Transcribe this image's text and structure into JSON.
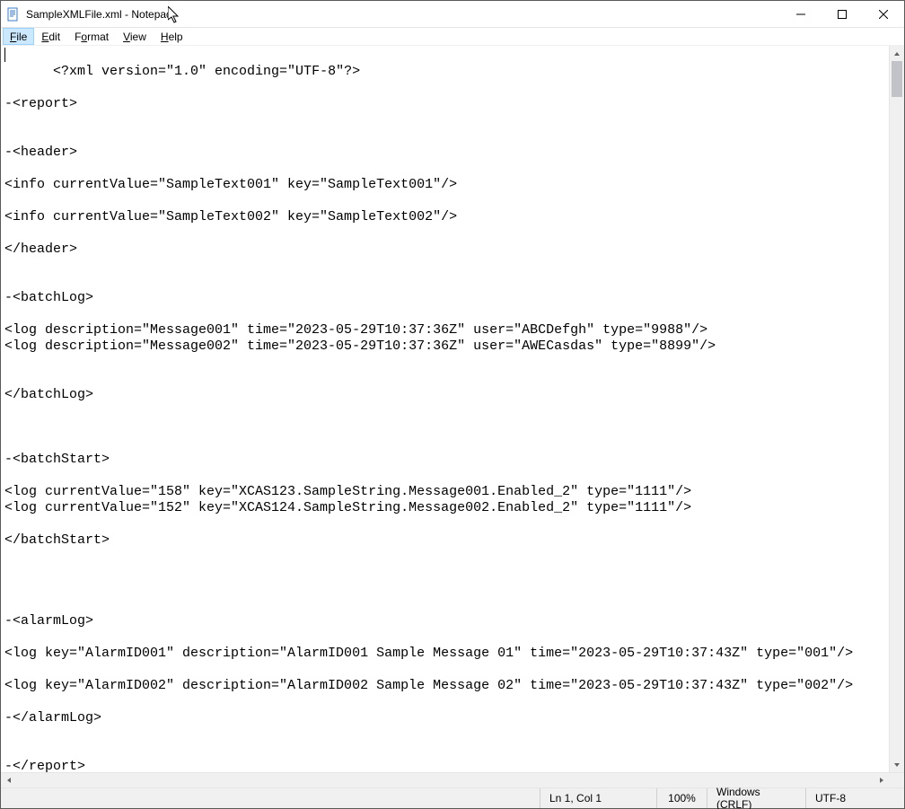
{
  "window": {
    "title": "SampleXMLFile.xml - Notepad"
  },
  "menu": {
    "file": "File",
    "edit": "Edit",
    "format": "Format",
    "view": "View",
    "help": "Help"
  },
  "editor": {
    "content": "<?xml version=\"1.0\" encoding=\"UTF-8\"?>\n\n-<report>\n\n\n-<header>\n\n<info currentValue=\"SampleText001\" key=\"SampleText001\"/>\n\n<info currentValue=\"SampleText002\" key=\"SampleText002\"/>\n\n</header>\n\n\n-<batchLog>\n\n<log description=\"Message001\" time=\"2023-05-29T10:37:36Z\" user=\"ABCDefgh\" type=\"9988\"/>\n<log description=\"Message002\" time=\"2023-05-29T10:37:36Z\" user=\"AWECasdas\" type=\"8899\"/>\n\n\n</batchLog>\n\n\n\n-<batchStart>\n\n<log currentValue=\"158\" key=\"XCAS123.SampleString.Message001.Enabled_2\" type=\"1111\"/>\n<log currentValue=\"152\" key=\"XCAS124.SampleString.Message002.Enabled_2\" type=\"1111\"/>\n\n</batchStart>\n\n\n\n\n-<alarmLog>\n\n<log key=\"AlarmID001\" description=\"AlarmID001 Sample Message 01\" time=\"2023-05-29T10:37:43Z\" type=\"001\"/>\n\n<log key=\"AlarmID002\" description=\"AlarmID002 Sample Message 02\" time=\"2023-05-29T10:37:43Z\" type=\"002\"/>\n\n-</alarmLog>\n\n\n-</report>"
  },
  "status": {
    "position": "Ln 1, Col 1",
    "zoom": "100%",
    "line_ending": "Windows (CRLF)",
    "encoding": "UTF-8"
  }
}
